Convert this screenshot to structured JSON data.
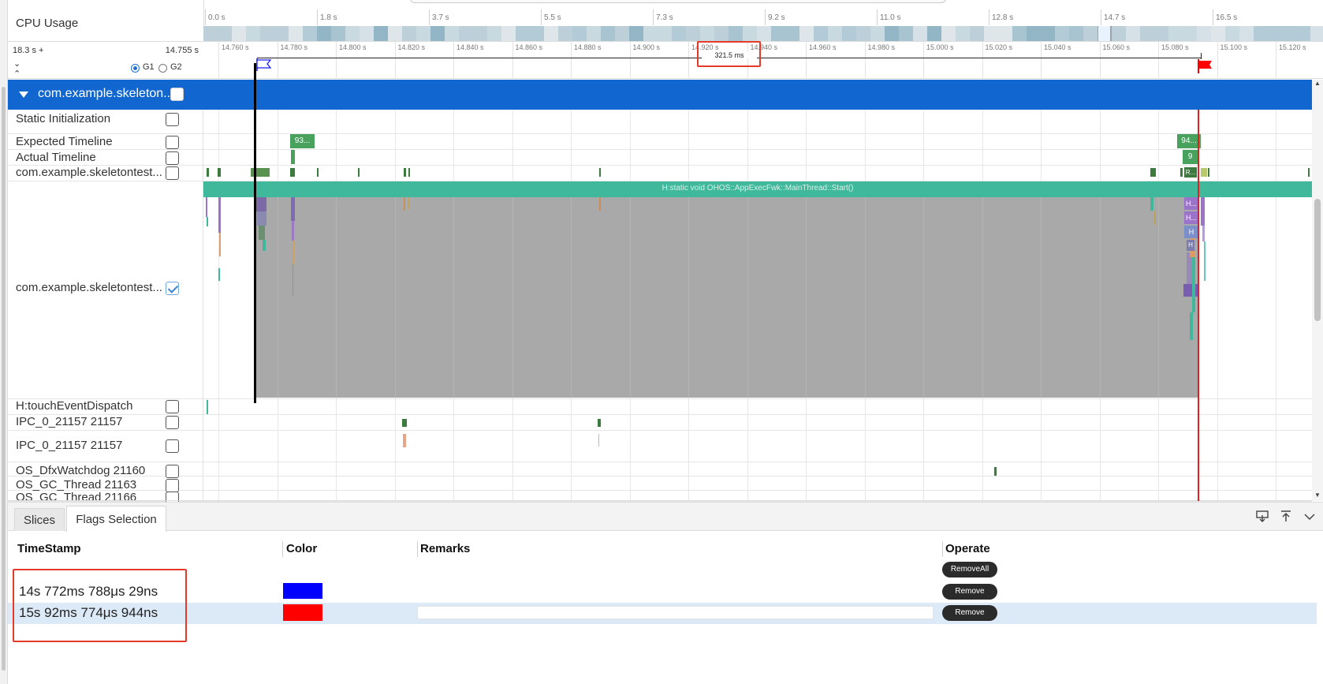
{
  "cpu_header": {
    "label": "CPU Usage",
    "ticks": [
      "0.0 s",
      "1.8 s",
      "3.7 s",
      "5.5 s",
      "7.3 s",
      "9.2 s",
      "11.0 s",
      "12.8 s",
      "14.7 s",
      "16.5 s"
    ]
  },
  "range_info": {
    "left_value": "18.3 s +",
    "right_value": "14.755 s",
    "group_options": [
      "G1",
      "G2"
    ],
    "selected_group": "G1",
    "fine_ticks": [
      "14.760 s",
      "14.780 s",
      "14.800 s",
      "14.820 s",
      "14.840 s",
      "14.860 s",
      "14.880 s",
      "14.900 s",
      "14.920 s",
      "14.940 s",
      "14.960 s",
      "14.980 s",
      "15.000 s",
      "15.020 s",
      "15.040 s",
      "15.060 s",
      "15.080 s",
      "15.100 s",
      "15.120 s"
    ],
    "duration_label": "321.5 ms"
  },
  "process": {
    "name": "com.example.skeleton...",
    "banner_color": "#1167cf"
  },
  "tracks": [
    {
      "label": "Static Initialization",
      "checked": false
    },
    {
      "label": "Expected Timeline",
      "checked": false
    },
    {
      "label": "Actual Timeline",
      "checked": false
    },
    {
      "label": "com.example.skeletontest...",
      "checked": false
    },
    {
      "label": "com.example.skeletontest...",
      "checked": true
    },
    {
      "label": "H:touchEventDispatch",
      "checked": false
    },
    {
      "label": "IPC_0_21157 21157",
      "checked": false
    },
    {
      "label": "IPC_0_21157 21157",
      "checked": false
    },
    {
      "label": "OS_DfxWatchdog 21160",
      "checked": false
    },
    {
      "label": "OS_GC_Thread 21163",
      "checked": false
    },
    {
      "label": "OS_GC_Thread 21166",
      "checked": false
    }
  ],
  "slice_labels": {
    "expected_left": "93...",
    "expected_right": "94...",
    "actual_right": "9",
    "thread_right": "R...",
    "main_thread": "H:static void OHOS::AppExecFwk::MainThread::Start()",
    "h1": "H...",
    "h2": "H...",
    "h3": "H",
    "h4": "H"
  },
  "bottom_tabs": {
    "items": [
      "Slices",
      "Flags Selection"
    ],
    "active": "Flags Selection"
  },
  "flags_table": {
    "headers": {
      "timestamp": "TimeStamp",
      "color": "Color",
      "remarks": "Remarks",
      "operate": "Operate"
    },
    "remove_all": "RemoveAll",
    "rows": [
      {
        "timestamp": "14s 772ms 788μs 29ns",
        "color": "#0000ff",
        "action": "Remove"
      },
      {
        "timestamp": "15s 92ms 774μs 944ns",
        "color": "#ff0000",
        "action": "Remove"
      }
    ]
  },
  "colors": {
    "flag_blue": "#1a1aff",
    "flag_red": "#ff0000",
    "main_thread_bar": "#3fb89c",
    "selection_overlay": "#9e9e9e",
    "highlight_box": "#e53a2a"
  }
}
